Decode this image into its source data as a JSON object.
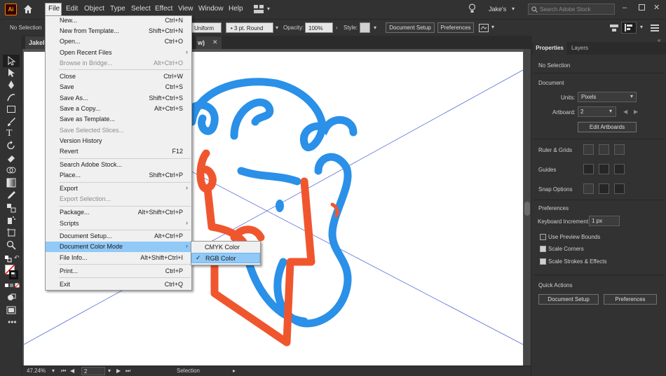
{
  "app": {
    "logo": "Ai"
  },
  "menubar": {
    "items": [
      "File",
      "Edit",
      "Object",
      "Type",
      "Select",
      "Effect",
      "View",
      "Window",
      "Help"
    ],
    "user": "Jake's",
    "search_placeholder": "Search Adobe Stock"
  },
  "controlbar": {
    "selection": "No Selection",
    "stroke_profile": "Uniform",
    "brush": "3 pt. Round",
    "opacity_label": "Opacity:",
    "opacity_value": "100%",
    "style_label": "Style:",
    "document_setup": "Document Setup",
    "preferences": "Preferences"
  },
  "document": {
    "tab_left": "JakeIr",
    "tab_right": "w)",
    "zoom": "47.24%",
    "artboard_number": "2",
    "status": "Selection"
  },
  "file_menu": {
    "items": [
      {
        "label": "New...",
        "shortcut": "Ctrl+N",
        "disabled": false
      },
      {
        "label": "New from Template...",
        "shortcut": "Shift+Ctrl+N",
        "disabled": false
      },
      {
        "label": "Open...",
        "shortcut": "Ctrl+O",
        "disabled": false
      },
      {
        "label": "Open Recent Files",
        "shortcut": "",
        "disabled": false,
        "submenu": true
      },
      {
        "label": "Browse in Bridge...",
        "shortcut": "Alt+Ctrl+O",
        "disabled": true
      },
      {
        "label": "Close",
        "shortcut": "Ctrl+W",
        "disabled": false
      },
      {
        "label": "Save",
        "shortcut": "Ctrl+S",
        "disabled": false
      },
      {
        "label": "Save As...",
        "shortcut": "Shift+Ctrl+S",
        "disabled": false
      },
      {
        "label": "Save a Copy...",
        "shortcut": "Alt+Ctrl+S",
        "disabled": false
      },
      {
        "label": "Save as Template...",
        "shortcut": "",
        "disabled": false
      },
      {
        "label": "Save Selected Slices...",
        "shortcut": "",
        "disabled": true
      },
      {
        "label": "Version History",
        "shortcut": "",
        "disabled": false
      },
      {
        "label": "Revert",
        "shortcut": "F12",
        "disabled": false
      },
      {
        "label": "Search Adobe Stock...",
        "shortcut": "",
        "disabled": false
      },
      {
        "label": "Place...",
        "shortcut": "Shift+Ctrl+P",
        "disabled": false
      },
      {
        "label": "Export",
        "shortcut": "",
        "disabled": false,
        "submenu": true
      },
      {
        "label": "Export Selection...",
        "shortcut": "",
        "disabled": true
      },
      {
        "label": "Package...",
        "shortcut": "Alt+Shift+Ctrl+P",
        "disabled": false
      },
      {
        "label": "Scripts",
        "shortcut": "",
        "disabled": false,
        "submenu": true
      },
      {
        "label": "Document Setup...",
        "shortcut": "Alt+Ctrl+P",
        "disabled": false
      },
      {
        "label": "Document Color Mode",
        "shortcut": "",
        "disabled": false,
        "submenu": true,
        "highlighted": true
      },
      {
        "label": "File Info...",
        "shortcut": "Alt+Shift+Ctrl+I",
        "disabled": false
      },
      {
        "label": "Print...",
        "shortcut": "Ctrl+P",
        "disabled": false
      },
      {
        "label": "Exit",
        "shortcut": "Ctrl+Q",
        "disabled": false
      }
    ]
  },
  "color_mode_submenu": {
    "items": [
      {
        "label": "CMYK Color",
        "checked": false
      },
      {
        "label": "RGB Color",
        "checked": true
      }
    ]
  },
  "panel": {
    "tabs": [
      "Properties",
      "Layers"
    ],
    "no_selection": "No Selection",
    "document_heading": "Document",
    "units_label": "Units:",
    "units_value": "Pixels",
    "artboard_label": "Artboard:",
    "artboard_value": "2",
    "edit_artboards": "Edit Artboards",
    "ruler_grids": "Ruler & Grids",
    "guides": "Guides",
    "snap_options": "Snap Options",
    "preferences_heading": "Preferences",
    "keyboard_increment_label": "Keyboard Increment:",
    "keyboard_increment_value": "1 px",
    "use_preview_bounds": "Use Preview Bounds",
    "scale_corners": "Scale Corners",
    "scale_strokes": "Scale Strokes & Effects",
    "checks": {
      "use_preview_bounds": false,
      "scale_corners": true,
      "scale_strokes": true
    },
    "quick_actions": "Quick Actions",
    "document_setup": "Document Setup",
    "preferences": "Preferences"
  },
  "colors": {
    "blue_stroke": "#2a90e8",
    "orange_stroke": "#f0562e",
    "guide": "#5a6fd8"
  }
}
